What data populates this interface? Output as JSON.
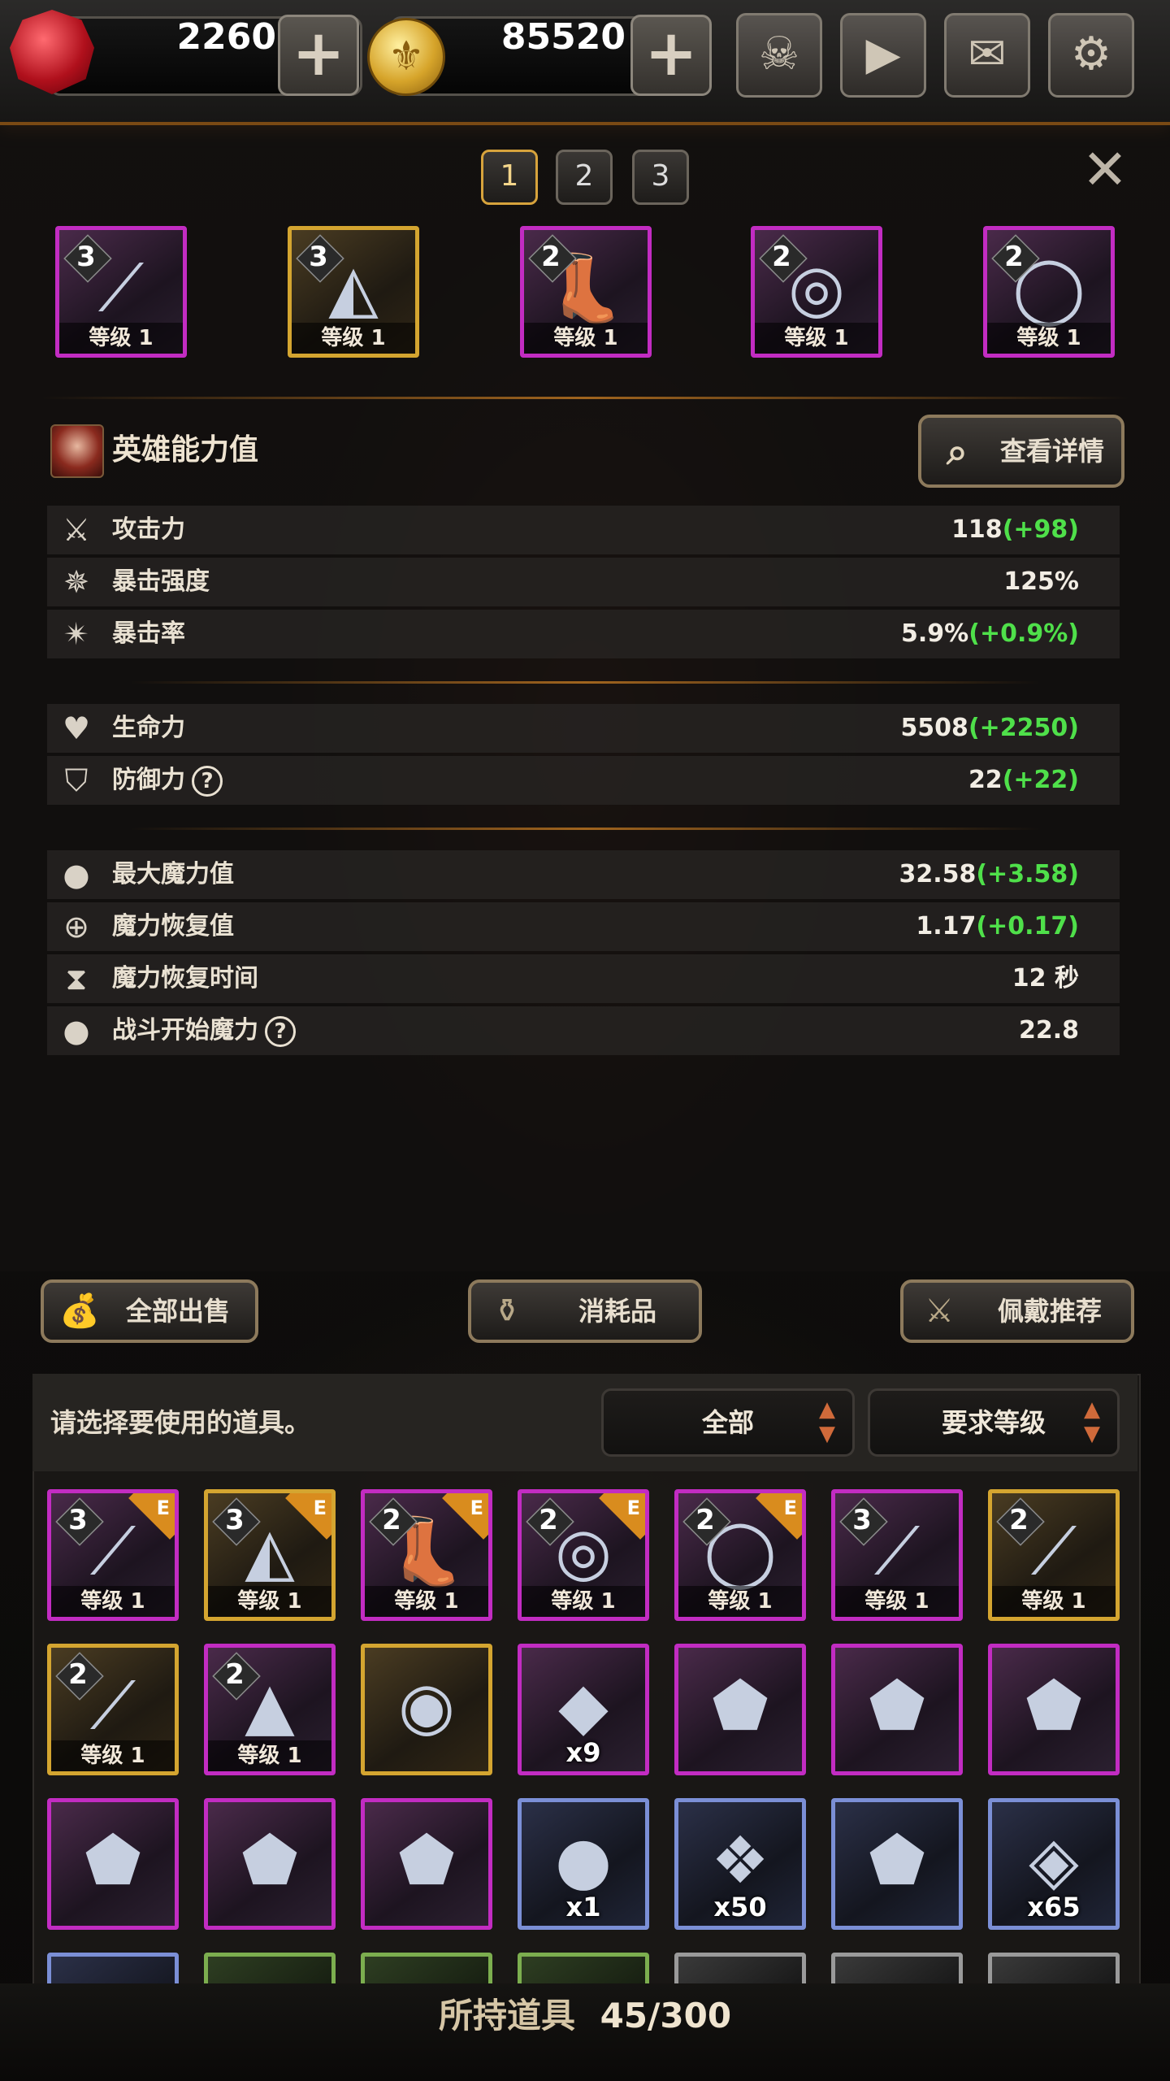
{
  "resources": {
    "gems": "2260",
    "gold": "85520",
    "plus": "+"
  },
  "menu": {
    "hero_icon": "☠",
    "video_icon": "▶",
    "mail_icon": "✉",
    "settings_icon": "⚙"
  },
  "pages": [
    "1",
    "2",
    "3"
  ],
  "active_page": "1",
  "close": "✕",
  "equipped": [
    {
      "tier": "3",
      "level": "等级 1",
      "rarity": "purple",
      "icon": "spear"
    },
    {
      "tier": "3",
      "level": "等级 1",
      "rarity": "gold",
      "icon": "cloak"
    },
    {
      "tier": "2",
      "level": "等级 1",
      "rarity": "purple",
      "icon": "boots"
    },
    {
      "tier": "2",
      "level": "等级 1",
      "rarity": "purple",
      "icon": "amulet"
    },
    {
      "tier": "2",
      "level": "等级 1",
      "rarity": "purple",
      "icon": "ring"
    }
  ],
  "stats_header": {
    "title": "英雄能力值",
    "details_button": "查看详情"
  },
  "stats": {
    "attack": {
      "label": "攻击力",
      "value": "118",
      "bonus": "(+98)"
    },
    "crit_power": {
      "label": "暴击强度",
      "value": "125%",
      "bonus": ""
    },
    "crit_rate": {
      "label": "暴击率",
      "value": "5.9%",
      "bonus": "(+0.9%)"
    },
    "hp": {
      "label": "生命力",
      "value": "5508",
      "bonus": "(+2250)"
    },
    "defense": {
      "label": "防御力",
      "value": "22",
      "bonus": "(+22)"
    },
    "max_mana": {
      "label": "最大魔力值",
      "value": "32.58",
      "bonus": "(+3.58)"
    },
    "mana_regen": {
      "label": "魔力恢复值",
      "value": "1.17",
      "bonus": "(+0.17)"
    },
    "mana_regen_time": {
      "label": "魔力恢复时间",
      "value": "12 秒",
      "bonus": ""
    },
    "start_mana": {
      "label": "战斗开始魔力",
      "value": "22.8",
      "bonus": ""
    }
  },
  "actions": {
    "sell_all": "全部出售",
    "consumables": "消耗品",
    "recommend": "佩戴推荐"
  },
  "inventory": {
    "prompt": "请选择要使用的道具。",
    "filter": "全部",
    "sort": "要求等级",
    "footer_label": "所持道具",
    "footer_count": "45/300",
    "equipped_tag": "E",
    "items": [
      {
        "tier": "3",
        "level": "等级 1",
        "rarity": "purple",
        "icon": "spear",
        "equipped": true
      },
      {
        "tier": "3",
        "level": "等级 1",
        "rarity": "gold",
        "icon": "cloak",
        "equipped": true
      },
      {
        "tier": "2",
        "level": "等级 1",
        "rarity": "purple",
        "icon": "boots",
        "equipped": true
      },
      {
        "tier": "2",
        "level": "等级 1",
        "rarity": "purple",
        "icon": "amulet",
        "equipped": true
      },
      {
        "tier": "2",
        "level": "等级 1",
        "rarity": "purple",
        "icon": "ring",
        "equipped": true
      },
      {
        "tier": "3",
        "level": "等级 1",
        "rarity": "purple",
        "icon": "spear",
        "equipped": false
      },
      {
        "tier": "2",
        "level": "等级 1",
        "rarity": "gold",
        "icon": "spear",
        "equipped": false
      },
      {
        "tier": "2",
        "level": "等级 1",
        "rarity": "gold",
        "icon": "spear",
        "equipped": false
      },
      {
        "tier": "2",
        "level": "等级 1",
        "rarity": "purple",
        "icon": "hood",
        "equipped": false
      },
      {
        "rarity": "gold",
        "icon": "compass"
      },
      {
        "rarity": "purple",
        "icon": "crystal",
        "qty": "x9"
      },
      {
        "rarity": "purple",
        "icon": "rune-stone"
      },
      {
        "rarity": "purple",
        "icon": "rune-stone"
      },
      {
        "rarity": "purple",
        "icon": "rune-stone"
      },
      {
        "rarity": "purple",
        "icon": "rune-stone"
      },
      {
        "rarity": "purple",
        "icon": "rune-stone"
      },
      {
        "rarity": "purple",
        "icon": "rune-stone"
      },
      {
        "rarity": "blue",
        "icon": "orb",
        "qty": "x1"
      },
      {
        "rarity": "blue",
        "icon": "ore",
        "qty": "x50"
      },
      {
        "rarity": "blue",
        "icon": "rune-stone"
      },
      {
        "rarity": "blue",
        "icon": "gem-shard",
        "qty": "x65"
      },
      {
        "rarity": "blue",
        "icon": "unknown"
      },
      {
        "rarity": "green",
        "icon": "unknown"
      },
      {
        "rarity": "green",
        "icon": "unknown"
      },
      {
        "rarity": "green",
        "icon": "unknown"
      },
      {
        "rarity": "grey",
        "icon": "unknown"
      },
      {
        "rarity": "grey",
        "icon": "unknown"
      },
      {
        "rarity": "grey",
        "icon": "unknown"
      }
    ]
  }
}
